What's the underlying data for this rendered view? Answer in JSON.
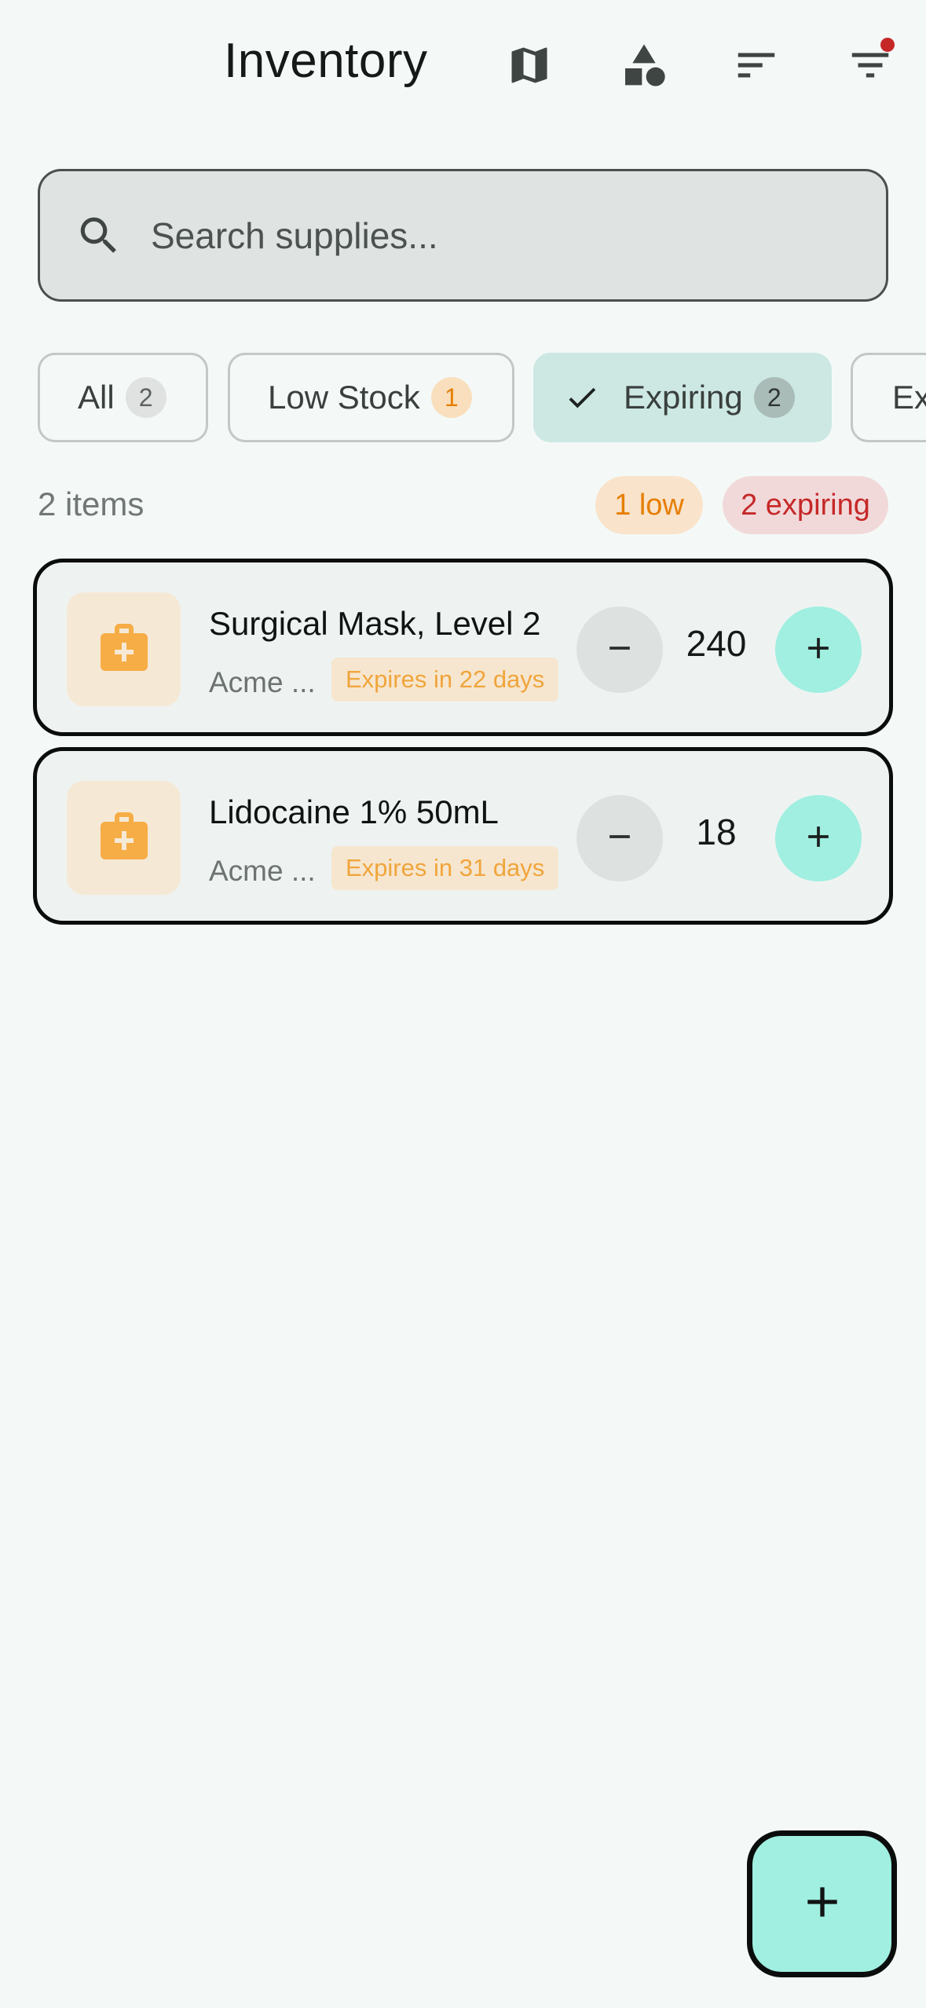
{
  "appbar": {
    "title": "Inventory",
    "icons": [
      "map-icon",
      "category-icon",
      "sort-icon",
      "filter-icon"
    ]
  },
  "search": {
    "placeholder": "Search supplies...",
    "value": ""
  },
  "chips": [
    {
      "label": "All",
      "count": "2",
      "selected": false
    },
    {
      "label": "Low Stock",
      "count": "1",
      "selected": false
    },
    {
      "label": "Expiring",
      "count": "2",
      "selected": true
    },
    {
      "label": "Ex",
      "count": "",
      "selected": false
    }
  ],
  "summary": {
    "items_count": "2 items",
    "low_pill": "1 low",
    "expiring_pill": "2 expiring"
  },
  "items": [
    {
      "name": "Surgical Mask, Level 2",
      "supplier": "Acme ...",
      "expiry": "Expires in 22 days",
      "quantity": "240",
      "icon": "medical-bag-icon"
    },
    {
      "name": "Lidocaine 1% 50mL",
      "supplier": "Acme ...",
      "expiry": "Expires in 31 days",
      "quantity": "18",
      "icon": "medical-bag-icon"
    }
  ],
  "fab": {
    "icon": "plus-icon"
  },
  "colors": {
    "background": "#f4f9f7",
    "accent": "#a0efe1",
    "warning": "#e67e00",
    "danger": "#c62828",
    "selected_chip": "#cde8e3"
  }
}
